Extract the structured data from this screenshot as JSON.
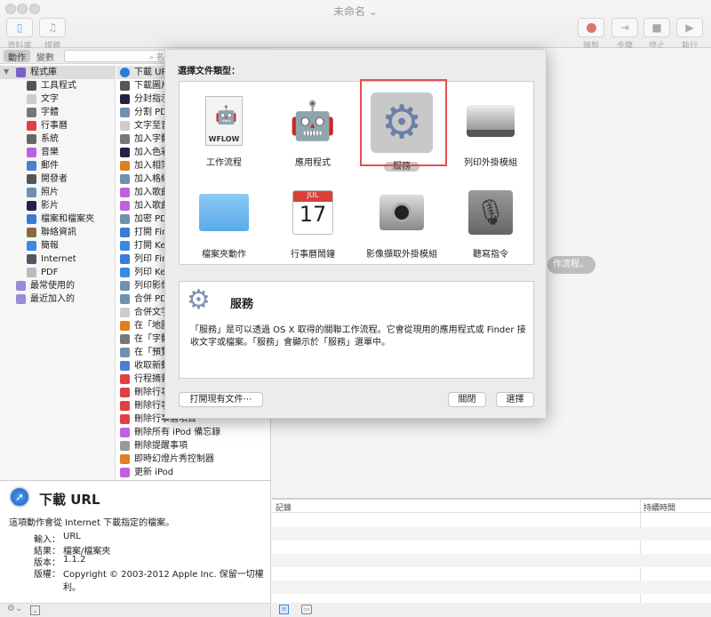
{
  "window": {
    "title": "未命名",
    "title_chevron": "⌄"
  },
  "toolbar": {
    "left": [
      {
        "label": "資料庫",
        "icon": "library-icon"
      },
      {
        "label": "媒體",
        "icon": "media-icon"
      }
    ],
    "right": [
      {
        "label": "錄製",
        "icon": "record-icon"
      },
      {
        "label": "步驟",
        "icon": "step-icon"
      },
      {
        "label": "停止",
        "icon": "stop-icon"
      },
      {
        "label": "執行",
        "icon": "run-icon"
      }
    ]
  },
  "left_tabs": {
    "actions": "動作",
    "variables": "變數",
    "search_placeholder": "名"
  },
  "library": [
    {
      "label": "程式庫",
      "color": "#7a5fc8"
    },
    {
      "label": "工具程式",
      "color": "#555"
    },
    {
      "label": "文字",
      "color": "#ccc"
    },
    {
      "label": "字體",
      "color": "#777"
    },
    {
      "label": "行事曆",
      "color": "#e04040"
    },
    {
      "label": "系統",
      "color": "#666"
    },
    {
      "label": "音樂",
      "color": "#c060e0"
    },
    {
      "label": "郵件",
      "color": "#4a80d0"
    },
    {
      "label": "開發者",
      "color": "#555"
    },
    {
      "label": "照片",
      "color": "#7090b0"
    },
    {
      "label": "影片",
      "color": "#224"
    },
    {
      "label": "檔案和檔案夾",
      "color": "#3a7ad8"
    },
    {
      "label": "聯絡資訊",
      "color": "#8a6a3a"
    },
    {
      "label": "簡報",
      "color": "#3a8ae0"
    },
    {
      "label": "Internet",
      "color": "#556"
    },
    {
      "label": "PDF",
      "color": "#bbb"
    },
    {
      "label": "最常使用的",
      "color": "#9a8ad8"
    },
    {
      "label": "最近加入的",
      "color": "#9a8ad8"
    }
  ],
  "actions": [
    {
      "label": "下載 URL",
      "color": "#2a7ae0"
    },
    {
      "label": "下載圖片",
      "color": "#555"
    },
    {
      "label": "分封指示",
      "color": "#224"
    },
    {
      "label": "分割 PDF",
      "color": "#7090b0"
    },
    {
      "label": "文字至音",
      "color": "#ccc"
    },
    {
      "label": "加入字體",
      "color": "#777"
    },
    {
      "label": "加入色彩",
      "color": "#224"
    },
    {
      "label": "加入相簿",
      "color": "#e08020"
    },
    {
      "label": "加入格線",
      "color": "#7090b0"
    },
    {
      "label": "加入歌曲",
      "color": "#c060e0"
    },
    {
      "label": "加入歌曲",
      "color": "#c060e0"
    },
    {
      "label": "加密 PDF",
      "color": "#7090b0"
    },
    {
      "label": "打開 Finder",
      "color": "#3a7ad8"
    },
    {
      "label": "打開 Keynote",
      "color": "#3a8ae0"
    },
    {
      "label": "列印 Finder",
      "color": "#3a7ad8"
    },
    {
      "label": "列印 Keynote",
      "color": "#3a8ae0"
    },
    {
      "label": "列印影像",
      "color": "#7090b0"
    },
    {
      "label": "合併 PDF",
      "color": "#7090b0"
    },
    {
      "label": "合併文字",
      "color": "#ccc"
    },
    {
      "label": "在「地圖」",
      "color": "#e08020"
    },
    {
      "label": "在「字體」",
      "color": "#777"
    },
    {
      "label": "在「預覽」",
      "color": "#7090b0"
    },
    {
      "label": "收取新郵件",
      "color": "#4a80d0"
    },
    {
      "label": "行程摘要",
      "color": "#e04040"
    },
    {
      "label": "刪除行事曆",
      "color": "#e04040"
    },
    {
      "label": "刪除行事曆",
      "color": "#e04040"
    },
    {
      "label": "刪除行事曆項目",
      "color": "#e04040"
    },
    {
      "label": "刪除所有 iPod 備忘錄",
      "color": "#c060e0"
    },
    {
      "label": "刪除提醒事項",
      "color": "#999"
    },
    {
      "label": "即時幻燈片秀控制器",
      "color": "#e08020"
    },
    {
      "label": "更新 iPod",
      "color": "#c060e0"
    }
  ],
  "info": {
    "title": "下載 URL",
    "description": "這項動作會從 Internet 下載指定的檔案。",
    "fields": [
      {
        "key": "輸入：",
        "value": "URL"
      },
      {
        "key": "結果：",
        "value": "檔案/檔案夾"
      },
      {
        "key": "版本：",
        "value": "1.1.2"
      },
      {
        "key": "版權：",
        "value": "Copyright © 2003-2012 Apple Inc. 保留一切權利。"
      }
    ]
  },
  "workflow": {
    "hint": "作流程。"
  },
  "log": {
    "col_log": "記錄",
    "col_duration": "持續時間"
  },
  "dialog": {
    "heading": "選擇文件類型：",
    "types": [
      {
        "label": "工作流程",
        "icon": "workflow-icon",
        "badge": "WFLOW"
      },
      {
        "label": "應用程式",
        "icon": "application-icon"
      },
      {
        "label": "服務",
        "icon": "service-gear-icon",
        "selected": true
      },
      {
        "label": "列印外掛模組",
        "icon": "printer-icon"
      },
      {
        "label": "檔案夾動作",
        "icon": "folder-icon"
      },
      {
        "label": "行事曆鬧鐘",
        "icon": "calendar-icon",
        "month": "JUL",
        "day": "17"
      },
      {
        "label": "影像擷取外掛模組",
        "icon": "camera-icon"
      },
      {
        "label": "聽寫指令",
        "icon": "microphone-icon"
      }
    ],
    "desc_title": "服務",
    "desc_text": "「服務」是可以透過 OS X 取得的關聯工作流程。它會從現用的應用程式或 Finder 接收文字或檔案。「服務」會顯示於「服務」選單中。",
    "open_existing": "打開現有文件⋯",
    "close": "關閉",
    "choose": "選擇"
  },
  "colors": {
    "selection_outline": "#e55050",
    "accent": "#2a7ae0"
  }
}
